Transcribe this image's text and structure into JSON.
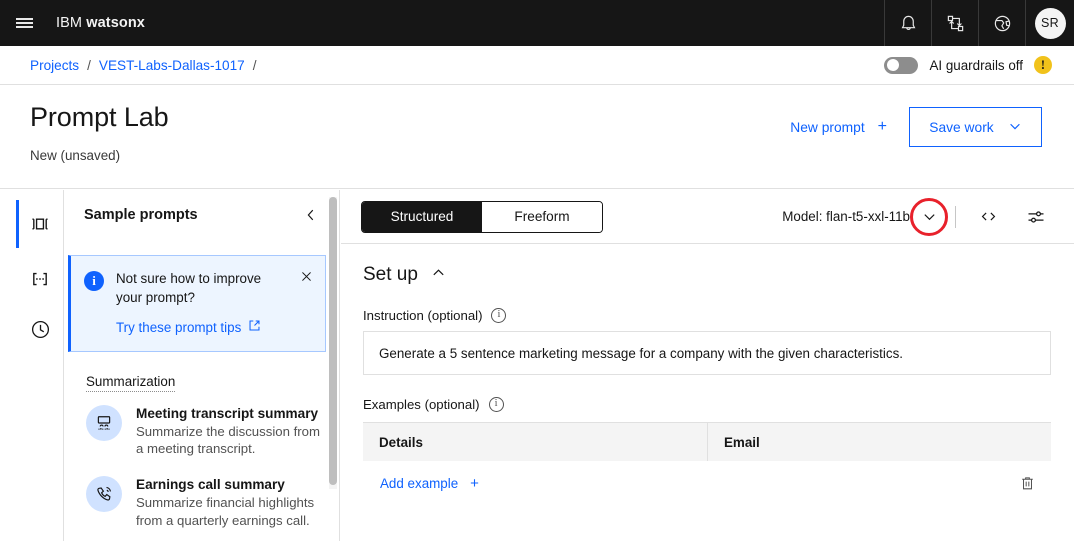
{
  "topnav": {
    "menu_icon": "hamburger-menu-icon",
    "brand_prefix": "IBM",
    "brand_name": "watsonx",
    "icons": [
      {
        "name": "notifications-bell-icon",
        "label": "Notifications"
      },
      {
        "name": "workflow-transform-icon",
        "label": "Transform"
      },
      {
        "name": "globe-region-icon",
        "label": "Region"
      }
    ],
    "avatar_initials": "SR"
  },
  "breadcrumb": {
    "items": [
      {
        "label": "Projects",
        "link": true
      },
      {
        "label": "VEST-Labs-Dallas-1017",
        "link": true
      }
    ],
    "separator": "/",
    "trailing_separator": "/",
    "guardrails": {
      "toggle_state": "off",
      "label": "AI guardrails off",
      "warning_glyph": "!",
      "warning_color": "#f1c21b"
    }
  },
  "page_header": {
    "title": "Prompt Lab",
    "subtitle": "New (unsaved)",
    "new_prompt_label": "New prompt",
    "new_prompt_glyph": "+",
    "save_work_label": "Save work",
    "save_work_caret": "chevron-down-icon"
  },
  "icon_rail": {
    "items": [
      {
        "name": "sample-prompts-panel-icon",
        "label": "Sample prompts",
        "active": true
      },
      {
        "name": "prompt-variables-icon",
        "label": "Prompt variables",
        "active": false
      },
      {
        "name": "history-clock-icon",
        "label": "History",
        "active": false
      }
    ]
  },
  "sample_panel": {
    "title": "Sample prompts",
    "collapse_icon": "chevron-left-icon",
    "info_box": {
      "icon": "info-filled-icon",
      "text": "Not sure how to improve your prompt?",
      "link_label": "Try these prompt tips",
      "link_icon": "external-link-icon",
      "close_icon": "close-icon",
      "accent_color": "#0f62fe",
      "background_color": "#edf5ff"
    },
    "category_label": "Summarization",
    "prompts": [
      {
        "icon": "presentation-audience-icon",
        "title": "Meeting transcript summary",
        "description": "Summarize the discussion from a meeting transcript."
      },
      {
        "icon": "phone-call-icon",
        "title": "Earnings call summary",
        "description": "Summarize financial highlights from a quarterly earnings call."
      }
    ]
  },
  "workspace": {
    "mode_tabs": [
      {
        "label": "Structured",
        "active": true
      },
      {
        "label": "Freeform",
        "active": false
      }
    ],
    "model_label": "Model: flan-t5-xxl-11b",
    "model_caret_icon": "chevron-down-icon",
    "highlight": {
      "shape": "circle",
      "color": "#e8212b",
      "target": "model-caret-icon"
    },
    "toolbar_icons": [
      {
        "name": "view-code-icon",
        "glyph": "</>"
      },
      {
        "name": "model-parameters-icon",
        "glyph": "sliders"
      }
    ],
    "setup": {
      "title": "Set up",
      "collapse_icon": "chevron-up-icon",
      "instruction_label": "Instruction (optional)",
      "instruction_info_icon": "info-icon",
      "instruction_value": "Generate a 5 sentence marketing message for a company with the given characteristics.",
      "examples_label": "Examples (optional)",
      "examples_info_icon": "info-icon",
      "table": {
        "columns": [
          "Details",
          "Email"
        ],
        "rows": []
      },
      "add_example_label": "Add example",
      "add_example_glyph": "+",
      "delete_icon": "trash-can-icon"
    }
  }
}
